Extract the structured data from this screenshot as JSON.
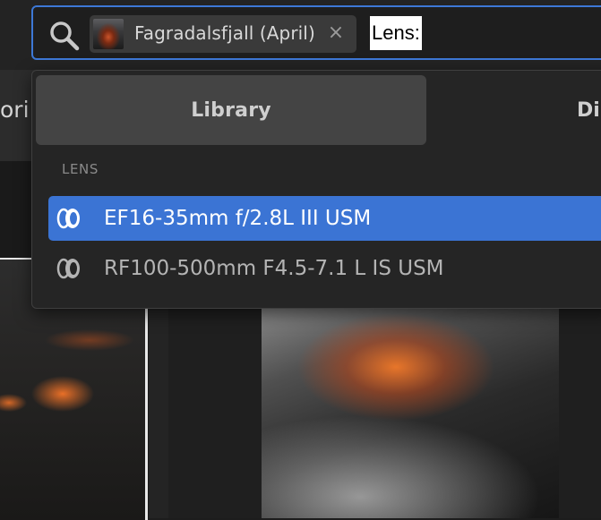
{
  "search": {
    "filter_chip": {
      "label": "Fagradalsfjall (April)",
      "close_glyph": "×"
    },
    "query": "Lens:",
    "icon": "search-icon"
  },
  "background": {
    "tab_left_partial": "ori",
    "tab_right_partial": "Di"
  },
  "dropdown": {
    "scope_tabs": [
      {
        "label": "Library",
        "selected": true
      }
    ],
    "section_heading": "LENS",
    "options": [
      {
        "label": "EF16-35mm f/2.8L III USM",
        "highlighted": true,
        "icon": "lens-icon"
      },
      {
        "label": "RF100-500mm F4.5-7.1 L IS USM",
        "highlighted": false,
        "icon": "lens-icon"
      }
    ]
  },
  "colors": {
    "accent": "#3b74d4",
    "focus_border": "#3d78d6",
    "panel": "#252525",
    "background": "#1d1d1d"
  }
}
